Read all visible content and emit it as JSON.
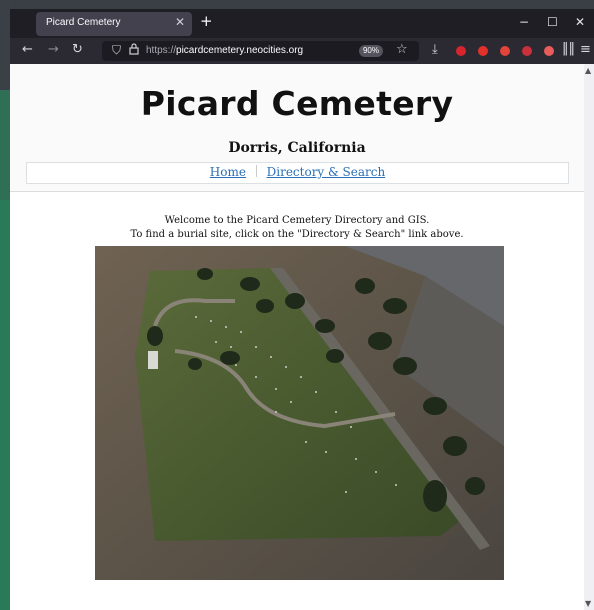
{
  "browser": {
    "tab_title": "Picard Cemetery",
    "url_prefix": "https://",
    "url_domain": "picardcemetery.neocities.org",
    "zoom": "90%"
  },
  "header": {
    "title": "Picard Cemetery",
    "subtitle": "Dorris, California"
  },
  "nav": {
    "home": "Home",
    "directory": "Directory & Search"
  },
  "main": {
    "welcome_line1": "Welcome to the Picard Cemetery Directory and GIS.",
    "welcome_line2": "To find a burial site, click on the \"Directory & Search\" link above."
  },
  "colors": {
    "link": "#2a6fb5",
    "tabbar": "#1f1e25",
    "navbar": "#2b2a33"
  },
  "icons": [
    "back-icon",
    "forward-icon",
    "reload-icon",
    "shield-icon",
    "lock-icon",
    "star-icon",
    "download-icon",
    "library-icon",
    "menu-icon"
  ]
}
